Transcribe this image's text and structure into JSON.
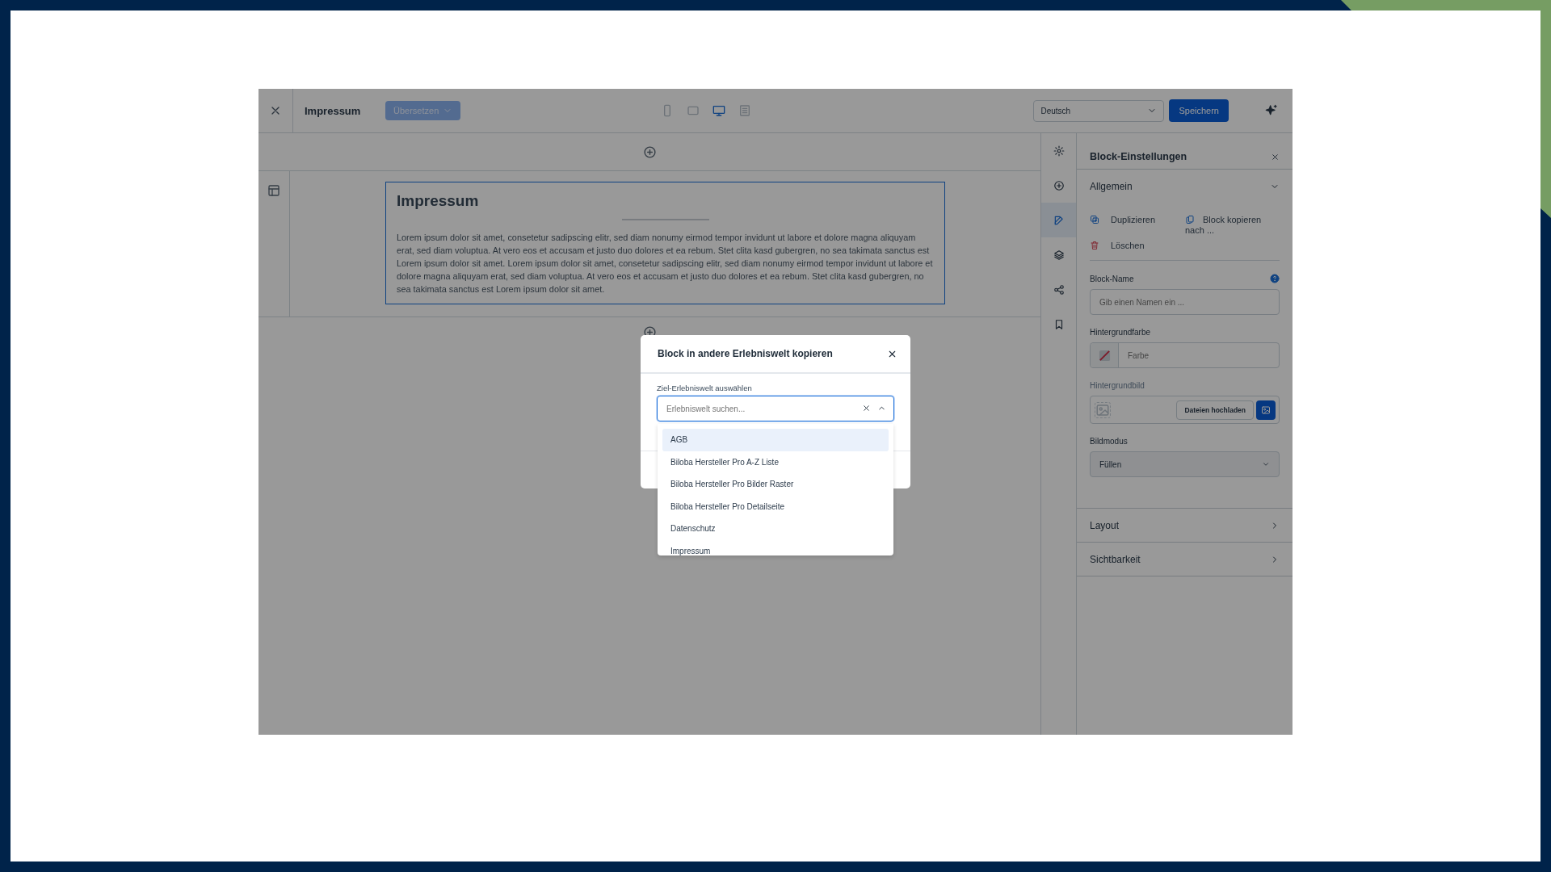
{
  "topbar": {
    "title": "Impressum",
    "translate_button": "Übersetzen",
    "devices": [
      {
        "kind": "phone",
        "selected": false
      },
      {
        "kind": "tablet",
        "selected": false
      },
      {
        "kind": "desktop",
        "selected": true
      },
      {
        "kind": "list",
        "selected": false
      }
    ],
    "language": "Deutsch",
    "save_button": "Speichern"
  },
  "canvas": {
    "block": {
      "heading": "Impressum",
      "body": "Lorem ipsum dolor sit amet, consetetur sadipscing elitr, sed diam nonumy eirmod tempor invidunt ut labore et dolore magna aliquyam erat, sed diam voluptua. At vero eos et accusam et justo duo dolores et ea rebum. Stet clita kasd gubergren, no sea takimata sanctus est Lorem ipsum dolor sit amet. Lorem ipsum dolor sit amet, consetetur sadipscing elitr, sed diam nonumy eirmod tempor invidunt ut labore et dolore magna aliquyam erat, sed diam voluptua. At vero eos et accusam et justo duo dolores et ea rebum. Stet clita kasd gubergren, no sea takimata sanctus est Lorem ipsum dolor sit amet."
    }
  },
  "rail": [
    {
      "kind": "settings",
      "selected": false
    },
    {
      "kind": "add",
      "selected": false
    },
    {
      "kind": "edit",
      "selected": true
    },
    {
      "kind": "layers",
      "selected": false
    },
    {
      "kind": "share",
      "selected": false
    },
    {
      "kind": "bookmark",
      "selected": false
    }
  ],
  "panel": {
    "title": "Block-Einstellungen",
    "sections": [
      {
        "title": "Allgemein",
        "expanded": true
      },
      {
        "title": "Layout",
        "expanded": false
      },
      {
        "title": "Sichtbarkeit",
        "expanded": false
      }
    ],
    "actions": [
      {
        "kind": "duplicate",
        "label": "Duplizieren"
      },
      {
        "kind": "copy",
        "label": "Block kopieren nach ..."
      },
      {
        "kind": "delete",
        "label": "Löschen"
      }
    ],
    "block_name": {
      "label": "Block-Name",
      "placeholder": "Gib einen Namen ein ..."
    },
    "background_color": {
      "label": "Hintergrundfarbe",
      "placeholder": "Farbe"
    },
    "background_image": {
      "label": "Hintergrundbild",
      "upload_button": "Dateien hochladen"
    },
    "image_mode": {
      "label": "Bildmodus",
      "value": "Füllen"
    }
  },
  "modal": {
    "title": "Block in andere Erlebniswelt kopieren",
    "field_label": "Ziel-Erlebniswelt auswählen",
    "search": {
      "placeholder": "Erlebniswelt suchen..."
    },
    "options": [
      {
        "label": "AGB",
        "selected": true
      },
      {
        "label": "Biloba Hersteller Pro A-Z Liste",
        "selected": false
      },
      {
        "label": "Biloba Hersteller Pro Bilder Raster",
        "selected": false
      },
      {
        "label": "Biloba Hersteller Pro Detailseite",
        "selected": false
      },
      {
        "label": "Datenschutz",
        "selected": false
      },
      {
        "label": "Impressum",
        "selected": false
      }
    ]
  }
}
